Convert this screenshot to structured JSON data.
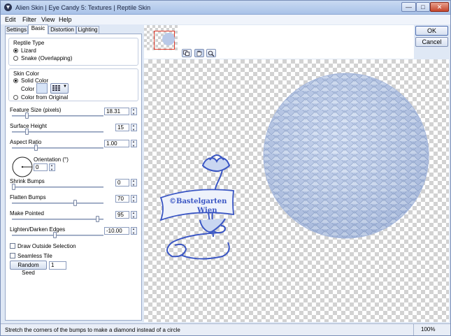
{
  "window": {
    "title": "Alien Skin | Eye Candy 5: Textures | Reptile Skin",
    "minimize": "—",
    "maximize": "□",
    "close": "✕"
  },
  "menu": [
    "Edit",
    "Filter",
    "View",
    "Help"
  ],
  "tabs": [
    {
      "label": "Settings",
      "active": false
    },
    {
      "label": "Basic",
      "active": true
    },
    {
      "label": "Distortion",
      "active": false
    },
    {
      "label": "Lighting",
      "active": false
    }
  ],
  "reptile_type": {
    "title": "Reptile Type",
    "options": [
      {
        "label": "Lizard",
        "selected": true
      },
      {
        "label": "Snake (Overlapping)",
        "selected": false
      }
    ]
  },
  "skin_color": {
    "title": "Skin Color",
    "solid_label": "Solid Color",
    "solid_selected": true,
    "color_label": "Color",
    "swatch_color": "#d7e4f7",
    "from_original_label": "Color from Original",
    "from_original_selected": false
  },
  "params": {
    "feature_size": {
      "label": "Feature Size (pixels)",
      "value": "18.31",
      "position": 0.15
    },
    "surface_height": {
      "label": "Surface Height",
      "value": "15",
      "position": 0.15
    },
    "aspect_ratio": {
      "label": "Aspect Ratio",
      "value": "1.00",
      "position": 0.25
    },
    "orientation": {
      "label": "Orientation (°)",
      "value": "0"
    },
    "shrink_bumps": {
      "label": "Shrink Bumps",
      "value": "0",
      "position": 0.0
    },
    "flatten_bumps": {
      "label": "Flatten Bumps",
      "value": "70",
      "position": 0.7
    },
    "make_pointed": {
      "label": "Make Pointed",
      "value": "95",
      "position": 0.95
    },
    "lighten_darken": {
      "label": "Lighten/Darken Edges",
      "value": "-10.00",
      "position": 0.47
    }
  },
  "checkboxes": {
    "draw_outside": {
      "label": "Draw Outside Selection",
      "checked": false
    },
    "seamless": {
      "label": "Seamless Tile",
      "checked": false
    }
  },
  "random_seed": {
    "button": "Random Seed",
    "value": "1"
  },
  "actions": {
    "ok": "OK",
    "cancel": "Cancel"
  },
  "watermark": {
    "line1": "©Bastelgarten",
    "line2": "Wien"
  },
  "status": {
    "text": "Stretch the corners of the bumps to make a diamond instead of a circle",
    "zoom": "100%"
  },
  "colors": {
    "accent": "#3a56c4",
    "scale": "#b9c9e8"
  }
}
